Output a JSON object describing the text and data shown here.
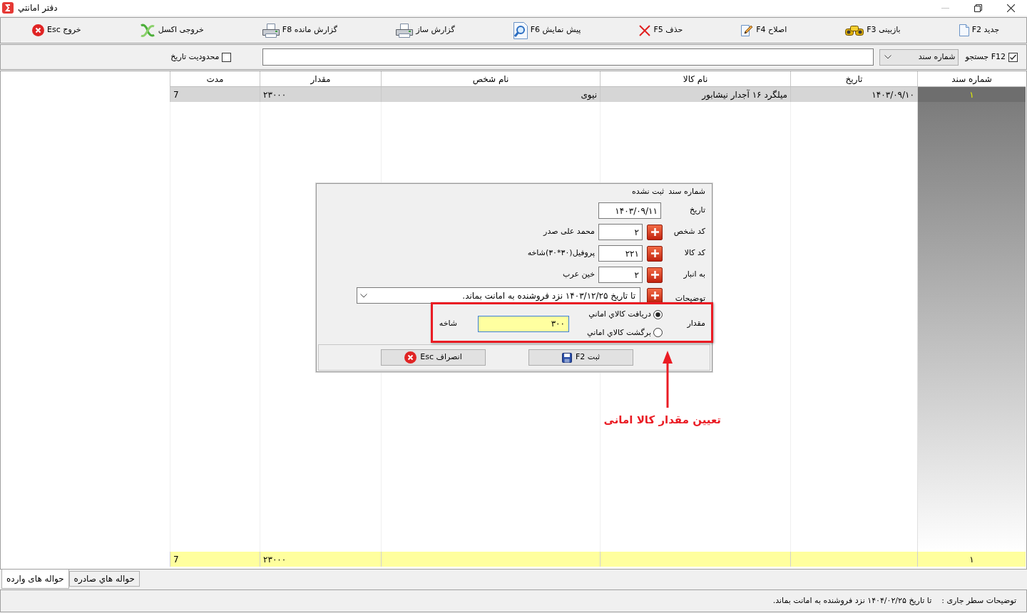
{
  "window": {
    "title": "دفتر امانتي"
  },
  "toolbar": [
    {
      "label": "جدید F2"
    },
    {
      "label": "بازبینی F3"
    },
    {
      "label": "اصلاح F4"
    },
    {
      "label": "حذف F5"
    },
    {
      "label": "پیش نمایش F6"
    },
    {
      "label": "گزارش ساز"
    },
    {
      "label": "گزارش مانده F8"
    },
    {
      "label": "خروجی اکسل"
    },
    {
      "label": "خروج Esc"
    }
  ],
  "search_bar": {
    "search_toggle": {
      "label": "F12 جستجو",
      "checked": true
    },
    "search_by": {
      "value": "شماره سند"
    },
    "date_limit": {
      "label": "محدودیت تاریخ",
      "checked": false
    }
  },
  "table": {
    "columns": [
      "شماره سند",
      "تاریخ",
      "نام کالا",
      "نام شخص",
      "مقدار",
      "مدت"
    ],
    "rows": [
      {
        "selected": true,
        "cells": [
          "۱",
          "۱۴۰۳/۰۹/۱۰",
          "میلگرد ۱۶ آجدار نیشابور",
          "نیوی",
          "۲۳۰۰۰",
          "7"
        ]
      }
    ],
    "totals": {
      "count": "۱",
      "amount": "۲۳۰۰۰",
      "duration": "7"
    }
  },
  "dialog": {
    "document_number": {
      "label": "شماره سند",
      "value": "ثبت نشده"
    },
    "fields": [
      {
        "kind": "date",
        "label": "تاریخ",
        "value": "۱۴۰۳/۰۹/۱۱"
      },
      {
        "kind": "lookup",
        "label": "کد شخص",
        "value": "۲",
        "name": "محمد علی صدر"
      },
      {
        "kind": "lookup",
        "label": "کد کالا",
        "value": "۲۲۱",
        "name": "پروفیل(۳۰*۳۰)شاخه"
      },
      {
        "kind": "lookup",
        "label": "به انبار",
        "value": "۲",
        "name": "خین عرب"
      },
      {
        "kind": "combo",
        "label": "توضیحات",
        "value": "تا تاریخ ۱۴۰۳/۱۲/۲۵ نزد فروشنده به امانت بماند."
      }
    ],
    "quantity": {
      "label": "مقدار",
      "options": [
        {
          "label": "دریافت کالاي اماني",
          "selected": true
        },
        {
          "label": "برگشت کالاي اماني",
          "selected": false
        }
      ],
      "value": "۳۰۰",
      "unit": "شاخه"
    },
    "buttons": [
      {
        "label": "ثبت F2"
      },
      {
        "label": "انصراف Esc"
      }
    ]
  },
  "annotation": {
    "caption": "تعیین مقدار کالا امانی"
  },
  "tabs": [
    {
      "label": "حواله هاي صادره",
      "selected": false
    },
    {
      "label": "حواله های وارده",
      "selected": true
    }
  ],
  "status_bar": {
    "label": "توضیحات سطر جاری :",
    "value": "تا تاریخ ۱۴۰۴/۰۲/۲۵ نزد فروشنده به امانت بماند."
  }
}
